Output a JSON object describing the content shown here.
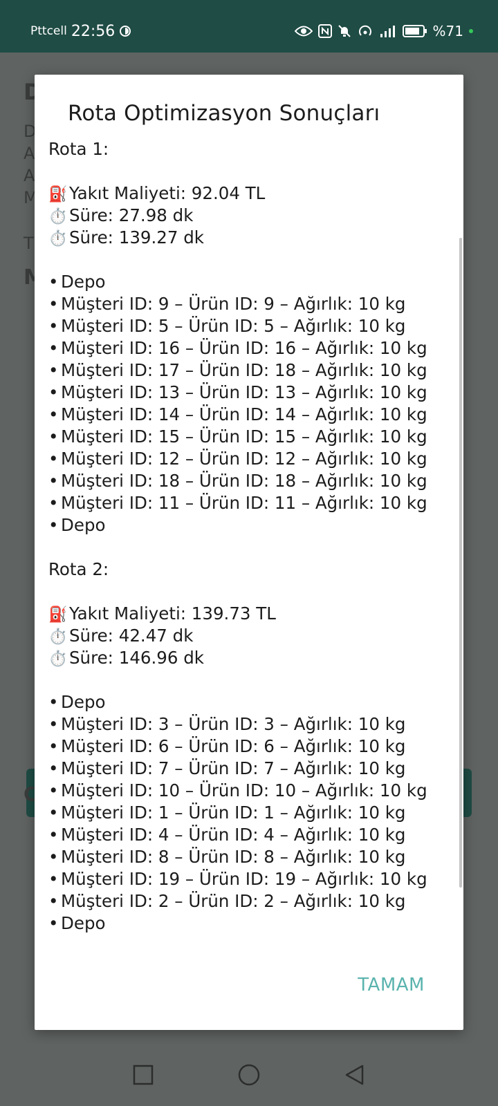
{
  "status_bar": {
    "carrier": "Pttcell",
    "time": "22:56",
    "battery": "%71"
  },
  "background": {
    "letters": [
      "D",
      "D",
      "A",
      "A",
      "M",
      "T",
      "M",
      "C"
    ]
  },
  "dialog": {
    "title": "Rota Optimizasyon Sonuçları",
    "ok_label": "TAMAM",
    "routes": [
      {
        "heading": "Rota 1:",
        "stats": [
          {
            "icon": "⛽",
            "icon_name": "fuel-pump-icon",
            "text": "Yakıt Maliyeti: 92.04 TL"
          },
          {
            "icon": "⏱️",
            "icon_name": "stopwatch-icon",
            "text": "Süre: 27.98 dk"
          },
          {
            "icon": "⏱️",
            "icon_name": "stopwatch-icon",
            "text": "Süre: 139.27 dk"
          }
        ],
        "stops": [
          "Depo",
          "Müşteri ID: 9 – Ürün ID: 9 – Ağırlık: 10 kg",
          "Müşteri ID: 5 – Ürün ID: 5 – Ağırlık: 10 kg",
          "Müşteri ID: 16 – Ürün ID: 16 – Ağırlık: 10 kg",
          "Müşteri ID: 17 – Ürün ID: 18 – Ağırlık: 10 kg",
          "Müşteri ID: 13 – Ürün ID: 13 – Ağırlık: 10 kg",
          "Müşteri ID: 14 – Ürün ID: 14 – Ağırlık: 10 kg",
          "Müşteri ID: 15 – Ürün ID: 15 – Ağırlık: 10 kg",
          "Müşteri ID: 12 – Ürün ID: 12 – Ağırlık: 10 kg",
          "Müşteri ID: 18 – Ürün ID: 18 – Ağırlık: 10 kg",
          "Müşteri ID: 11 – Ürün ID: 11 – Ağırlık: 10 kg",
          "Depo"
        ]
      },
      {
        "heading": "Rota 2:",
        "stats": [
          {
            "icon": "⛽",
            "icon_name": "fuel-pump-icon",
            "text": "Yakıt Maliyeti: 139.73 TL"
          },
          {
            "icon": "⏱️",
            "icon_name": "stopwatch-icon",
            "text": "Süre: 42.47 dk"
          },
          {
            "icon": "⏱️",
            "icon_name": "stopwatch-icon",
            "text": "Süre: 146.96 dk"
          }
        ],
        "stops": [
          "Depo",
          "Müşteri ID: 3 – Ürün ID: 3 – Ağırlık: 10 kg",
          "Müşteri ID: 6 – Ürün ID: 6 – Ağırlık: 10 kg",
          "Müşteri ID: 7 – Ürün ID: 7 – Ağırlık: 10 kg",
          "Müşteri ID: 10 – Ürün ID: 10 – Ağırlık: 10 kg",
          "Müşteri ID: 1 – Ürün ID: 1 – Ağırlık: 10 kg",
          "Müşteri ID: 4 – Ürün ID: 4 – Ağırlık: 10 kg",
          "Müşteri ID: 8 – Ürün ID: 8 – Ağırlık: 10 kg",
          "Müşteri ID: 19 – Ürün ID: 19 – Ağırlık: 10 kg",
          "Müşteri ID: 2 – Ürün ID: 2 – Ağırlık: 10 kg",
          "Depo"
        ]
      }
    ]
  },
  "nav_bar": {
    "buttons": [
      "recents-icon",
      "home-icon",
      "back-icon"
    ]
  }
}
